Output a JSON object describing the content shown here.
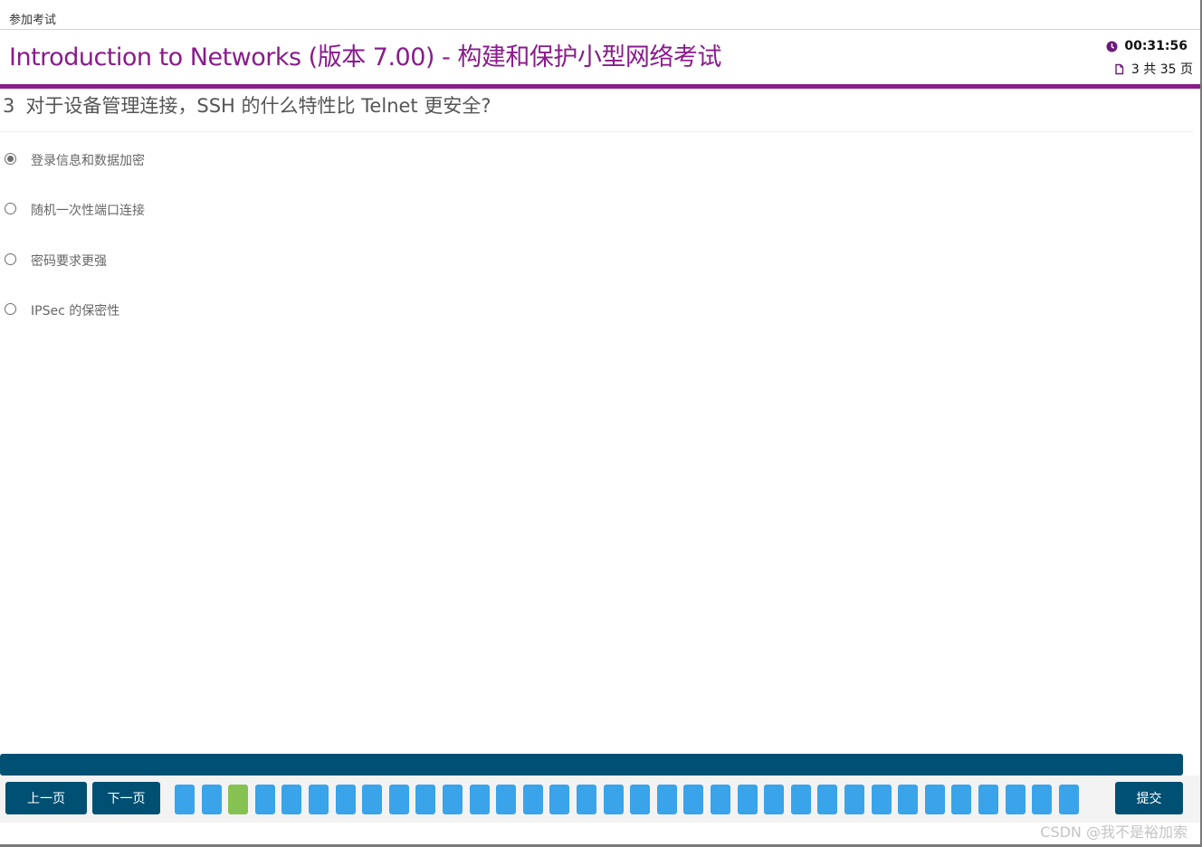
{
  "topbar": {
    "title": "参加考试"
  },
  "header": {
    "exam_title": "Introduction to Networks (版本 7.00) - 构建和保护小型网络考试",
    "timer_icon": "clock-icon",
    "timer": "00:31:56",
    "page_icon": "document-icon",
    "page_indicator": "3 共 35 页"
  },
  "question": {
    "number": "3",
    "text": "对于设备管理连接，SSH 的什么特性比 Telnet 更安全?",
    "options": [
      {
        "label": "登录信息和数据加密",
        "selected": true
      },
      {
        "label": "随机一次性端口连接",
        "selected": false
      },
      {
        "label": "密码要求更强",
        "selected": false
      },
      {
        "label": "IPSec 的保密性",
        "selected": false
      }
    ]
  },
  "navigation": {
    "prev_label": "上一页",
    "next_label": "下一页",
    "submit_label": "提交",
    "question_count": 35,
    "current_question": 3
  },
  "colors": {
    "accent": "#8a1b8c",
    "nav_dark": "#005073",
    "tile": "#39a4ea",
    "tile_current": "#85c252"
  },
  "watermark": "CSDN @我不是裕加索"
}
